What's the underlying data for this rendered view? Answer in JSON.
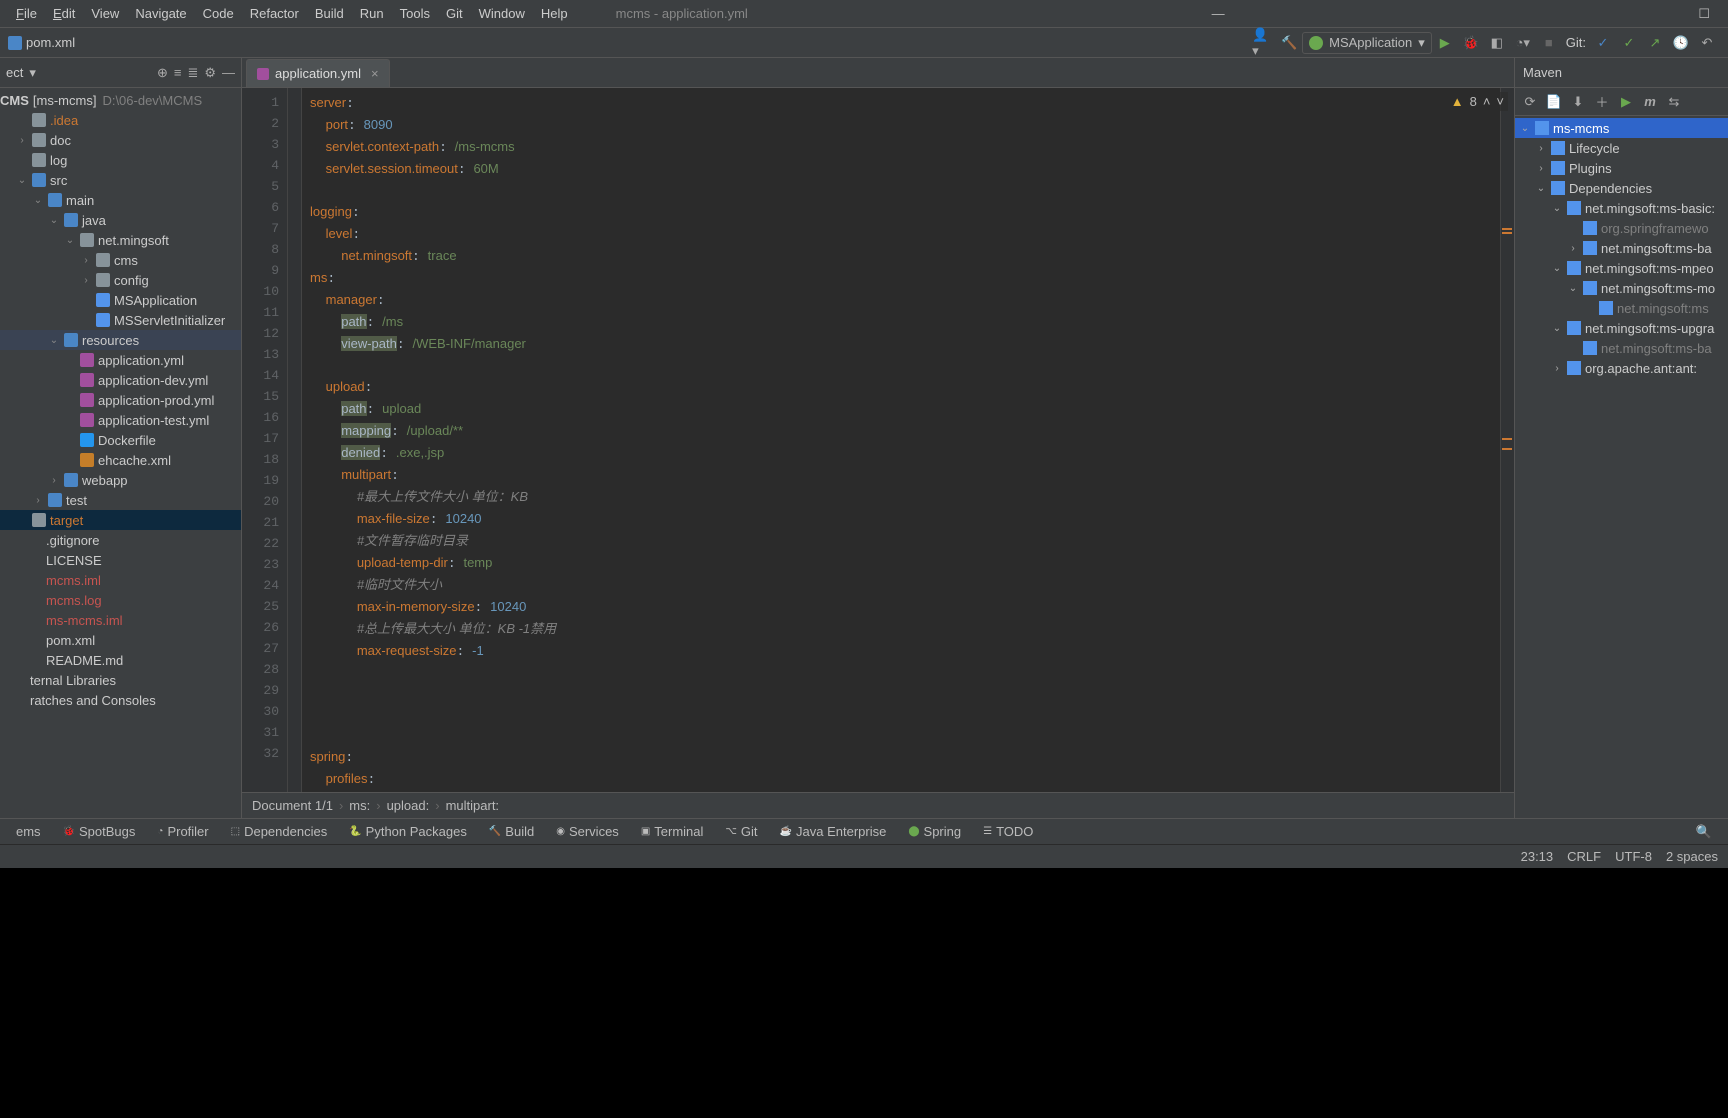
{
  "menu": {
    "file": "File",
    "edit": "Edit",
    "view": "View",
    "navigate": "Navigate",
    "code": "Code",
    "refactor": "Refactor",
    "build": "Build",
    "run": "Run",
    "tools": "Tools",
    "git": "Git",
    "window": "Window",
    "help": "Help"
  },
  "window_title": "mcms - application.yml",
  "breadcrumb_file": "pom.xml",
  "run_config": "MSApplication",
  "git_label": "Git:",
  "project": {
    "header": "ect",
    "root": "CMS",
    "root_bracket": "[ms-mcms]",
    "root_path": "D:\\06-dev\\MCMS",
    "items": [
      {
        "ind": 1,
        "arr": "",
        "ic": "ic-folder",
        "nm": ".idea",
        "cls": "orange"
      },
      {
        "ind": 1,
        "arr": "›",
        "ic": "ic-folder",
        "nm": "doc"
      },
      {
        "ind": 1,
        "arr": "",
        "ic": "ic-folder",
        "nm": "log"
      },
      {
        "ind": 1,
        "arr": "⌄",
        "ic": "ic-folder-blue",
        "nm": "src"
      },
      {
        "ind": 2,
        "arr": "⌄",
        "ic": "ic-folder-blue",
        "nm": "main"
      },
      {
        "ind": 3,
        "arr": "⌄",
        "ic": "ic-folder-blue",
        "nm": "java"
      },
      {
        "ind": 4,
        "arr": "⌄",
        "ic": "ic-folder",
        "nm": "net.mingsoft"
      },
      {
        "ind": 5,
        "arr": "›",
        "ic": "ic-folder",
        "nm": "cms"
      },
      {
        "ind": 5,
        "arr": "›",
        "ic": "ic-folder",
        "nm": "config"
      },
      {
        "ind": 5,
        "arr": "",
        "ic": "ic-app",
        "nm": "MSApplication"
      },
      {
        "ind": 5,
        "arr": "",
        "ic": "ic-app",
        "nm": "MSServletInitializer"
      },
      {
        "ind": 3,
        "arr": "⌄",
        "ic": "ic-folder-blue",
        "nm": "resources",
        "sel": true
      },
      {
        "ind": 4,
        "arr": "",
        "ic": "ic-yaml",
        "nm": "application.yml"
      },
      {
        "ind": 4,
        "arr": "",
        "ic": "ic-yaml",
        "nm": "application-dev.yml"
      },
      {
        "ind": 4,
        "arr": "",
        "ic": "ic-yaml",
        "nm": "application-prod.yml"
      },
      {
        "ind": 4,
        "arr": "",
        "ic": "ic-yaml",
        "nm": "application-test.yml"
      },
      {
        "ind": 4,
        "arr": "",
        "ic": "ic-docker",
        "nm": "Dockerfile"
      },
      {
        "ind": 4,
        "arr": "",
        "ic": "ic-xml",
        "nm": "ehcache.xml"
      },
      {
        "ind": 3,
        "arr": "›",
        "ic": "ic-folder-blue",
        "nm": "webapp"
      },
      {
        "ind": 2,
        "arr": "›",
        "ic": "ic-folder-blue",
        "nm": "test"
      },
      {
        "ind": 1,
        "arr": "",
        "ic": "ic-folder",
        "nm": "target",
        "cls": "orange",
        "selstrong": true
      },
      {
        "ind": 1,
        "arr": "",
        "ic": "",
        "nm": ".gitignore"
      },
      {
        "ind": 1,
        "arr": "",
        "ic": "",
        "nm": "LICENSE"
      },
      {
        "ind": 1,
        "arr": "",
        "ic": "",
        "nm": "mcms.iml",
        "cls": "red"
      },
      {
        "ind": 1,
        "arr": "",
        "ic": "",
        "nm": "mcms.log",
        "cls": "red"
      },
      {
        "ind": 1,
        "arr": "",
        "ic": "",
        "nm": "ms-mcms.iml",
        "cls": "red"
      },
      {
        "ind": 1,
        "arr": "",
        "ic": "",
        "nm": "pom.xml"
      },
      {
        "ind": 1,
        "arr": "",
        "ic": "",
        "nm": "README.md"
      },
      {
        "ind": 0,
        "arr": "",
        "ic": "",
        "nm": "ternal Libraries"
      },
      {
        "ind": 0,
        "arr": "",
        "ic": "",
        "nm": "ratches and Consoles"
      }
    ]
  },
  "tab_name": "application.yml",
  "inspection": {
    "warn_count": "8"
  },
  "code_lines": [
    {
      "n": 1,
      "html": "<span class='k'>server</span>:"
    },
    {
      "n": 2,
      "html": "  <span class='k'>port</span>: <span class='n'>8090</span>"
    },
    {
      "n": 3,
      "html": "  <span class='k'>servlet.context-path</span>: <span class='s'>/ms-mcms</span>"
    },
    {
      "n": 4,
      "html": "  <span class='k'>servlet.session.timeout</span>: <span class='s'>60M</span>"
    },
    {
      "n": 5,
      "html": ""
    },
    {
      "n": 6,
      "html": "<span class='k'>logging</span>:"
    },
    {
      "n": 7,
      "html": "  <span class='k'>level</span>:"
    },
    {
      "n": 8,
      "html": "    <span class='k'>net.mingsoft</span>: <span class='s'>trace</span>"
    },
    {
      "n": 9,
      "html": "<span class='k'>ms</span>:"
    },
    {
      "n": 10,
      "html": "  <span class='k'>manager</span>:"
    },
    {
      "n": 11,
      "html": "    <span class='hl'>path</span>: <span class='s'>/ms</span>"
    },
    {
      "n": 12,
      "html": "    <span class='hl'>view-path</span>: <span class='s'>/WEB-INF/manager</span>"
    },
    {
      "n": 13,
      "html": ""
    },
    {
      "n": 14,
      "html": "  <span class='k'>upload</span>:"
    },
    {
      "n": 15,
      "html": "    <span class='hl'>path</span>: <span class='s'>upload</span>"
    },
    {
      "n": 16,
      "html": "    <span class='hl'>mapping</span>: <span class='s'>/upload/**</span>"
    },
    {
      "n": 17,
      "html": "    <span class='hl'>denied</span>: <span class='s'>.exe,.jsp</span>"
    },
    {
      "n": 18,
      "html": "    <span class='k'>multipart</span>:"
    },
    {
      "n": 19,
      "html": "      <span class='c'>#最大上传文件大小 单位：KB</span>"
    },
    {
      "n": 20,
      "html": "      <span class='k'>max-file-size</span>: <span class='n'>10240</span>"
    },
    {
      "n": 21,
      "html": "      <span class='c'>#文件暂存临时目录</span>"
    },
    {
      "n": 22,
      "html": "      <span class='k'>upload-temp-dir</span>: <span class='s'>temp</span>"
    },
    {
      "n": 23,
      "html": "      <span class='c'>#临时文件大小</span>"
    },
    {
      "n": 24,
      "html": "      <span class='k'>max-in-memory-size</span>: <span class='n'>10240</span>"
    },
    {
      "n": 25,
      "html": "      <span class='c'>#总上传最大大小 单位：KB -1禁用</span>"
    },
    {
      "n": 26,
      "html": "      <span class='k'>max-request-size</span>: <span class='n'>-1</span>"
    },
    {
      "n": 27,
      "html": ""
    },
    {
      "n": 28,
      "html": ""
    },
    {
      "n": 29,
      "html": ""
    },
    {
      "n": 30,
      "html": ""
    },
    {
      "n": 31,
      "html": "<span class='k'>spring</span>:"
    },
    {
      "n": 32,
      "html": "  <span class='k'>profiles</span>:"
    }
  ],
  "crumbs": {
    "doc": "Document 1/1",
    "a": "ms:",
    "b": "upload:",
    "c": "multipart:"
  },
  "maven": {
    "title": "Maven",
    "root": "ms-mcms",
    "items": [
      {
        "ind": 1,
        "arr": "›",
        "ic": "ic-folder",
        "nm": "Lifecycle"
      },
      {
        "ind": 1,
        "arr": "›",
        "ic": "ic-folder",
        "nm": "Plugins"
      },
      {
        "ind": 1,
        "arr": "⌄",
        "ic": "ic-folder",
        "nm": "Dependencies"
      },
      {
        "ind": 2,
        "arr": "⌄",
        "ic": "mic-bars",
        "nm": "net.mingsoft:ms-basic:"
      },
      {
        "ind": 3,
        "arr": "",
        "ic": "mic-bars",
        "nm": "org.springframewo",
        "dim": true
      },
      {
        "ind": 3,
        "arr": "›",
        "ic": "mic-bars",
        "nm": "net.mingsoft:ms-ba"
      },
      {
        "ind": 2,
        "arr": "⌄",
        "ic": "mic-bars",
        "nm": "net.mingsoft:ms-mpeo"
      },
      {
        "ind": 3,
        "arr": "⌄",
        "ic": "mic-bars",
        "nm": "net.mingsoft:ms-mo"
      },
      {
        "ind": 4,
        "arr": "",
        "ic": "mic-bars",
        "nm": "net.mingsoft:ms",
        "dim": true
      },
      {
        "ind": 2,
        "arr": "⌄",
        "ic": "mic-bars",
        "nm": "net.mingsoft:ms-upgra"
      },
      {
        "ind": 3,
        "arr": "",
        "ic": "mic-bars",
        "nm": "net.mingsoft:ms-ba",
        "dim": true
      },
      {
        "ind": 2,
        "arr": "›",
        "ic": "mic-bars",
        "nm": "org.apache.ant:ant:"
      }
    ]
  },
  "toolstrip": {
    "problems": "ems",
    "spotbugs": "SpotBugs",
    "profiler": "Profiler",
    "deps": "Dependencies",
    "pypkg": "Python Packages",
    "build": "Build",
    "services": "Services",
    "terminal": "Terminal",
    "git": "Git",
    "javaee": "Java Enterprise",
    "spring": "Spring",
    "todo": "TODO"
  },
  "status": {
    "pos": "23:13",
    "sep": "CRLF",
    "enc": "UTF-8",
    "indent": "2 spaces"
  }
}
